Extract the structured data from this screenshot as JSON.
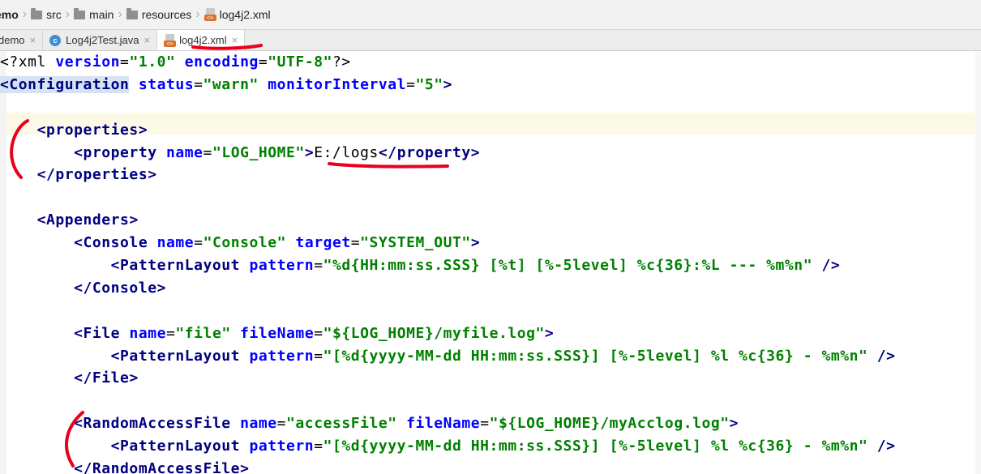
{
  "breadcrumb": {
    "items": [
      {
        "label": "emo",
        "icon": "none"
      },
      {
        "label": "src",
        "icon": "folder-icon"
      },
      {
        "label": "main",
        "icon": "folder-icon"
      },
      {
        "label": "resources",
        "icon": "resources-folder-icon"
      },
      {
        "label": "log4j2.xml",
        "icon": "xml-file-icon"
      }
    ]
  },
  "tabs": [
    {
      "label": "demo",
      "icon": "none",
      "active": false
    },
    {
      "label": "Log4j2Test.java",
      "icon": "java-class-icon",
      "active": false
    },
    {
      "label": "log4j2.xml",
      "icon": "xml-file-icon",
      "active": true
    }
  ],
  "tab_close_glyph": "×",
  "xml_icon_text": "<>",
  "java_icon_text": "c",
  "editor": {
    "lines": [
      {
        "text": "<?xml version=\"1.0\" encoding=\"UTF-8\"?>"
      },
      {
        "text": "<Configuration status=\"warn\" monitorInterval=\"5\">"
      },
      {
        "text": ""
      },
      {
        "text": "    <properties>"
      },
      {
        "text": "        <property name=\"LOG_HOME\">E:/logs</property>"
      },
      {
        "text": "    </properties>"
      },
      {
        "text": ""
      },
      {
        "text": "    <Appenders>"
      },
      {
        "text": "        <Console name=\"Console\" target=\"SYSTEM_OUT\">"
      },
      {
        "text": "            <PatternLayout pattern=\"%d{HH:mm:ss.SSS} [%t] [%-5level] %c{36}:%L --- %m%n\" />"
      },
      {
        "text": "        </Console>"
      },
      {
        "text": ""
      },
      {
        "text": "        <File name=\"file\" fileName=\"${LOG_HOME}/myfile.log\">"
      },
      {
        "text": "            <PatternLayout pattern=\"[%d{yyyy-MM-dd HH:mm:ss.SSS}] [%-5level] %l %c{36} - %m%n\" />"
      },
      {
        "text": "        </File>"
      },
      {
        "text": ""
      },
      {
        "text": "        <RandomAccessFile name=\"accessFile\" fileName=\"${LOG_HOME}/myAcclog.log\">"
      },
      {
        "text": "            <PatternLayout pattern=\"[%d{yyyy-MM-dd HH:mm:ss.SSS}] [%-5level] %l %c{36} - %m%n\" />"
      },
      {
        "text": "        </RandomAccessFile>"
      }
    ]
  },
  "colors": {
    "tag": "#000080",
    "attribute": "#0000ff",
    "value": "#008000",
    "annotation": "#e8001c",
    "tab_highlight": "#ffffff"
  }
}
